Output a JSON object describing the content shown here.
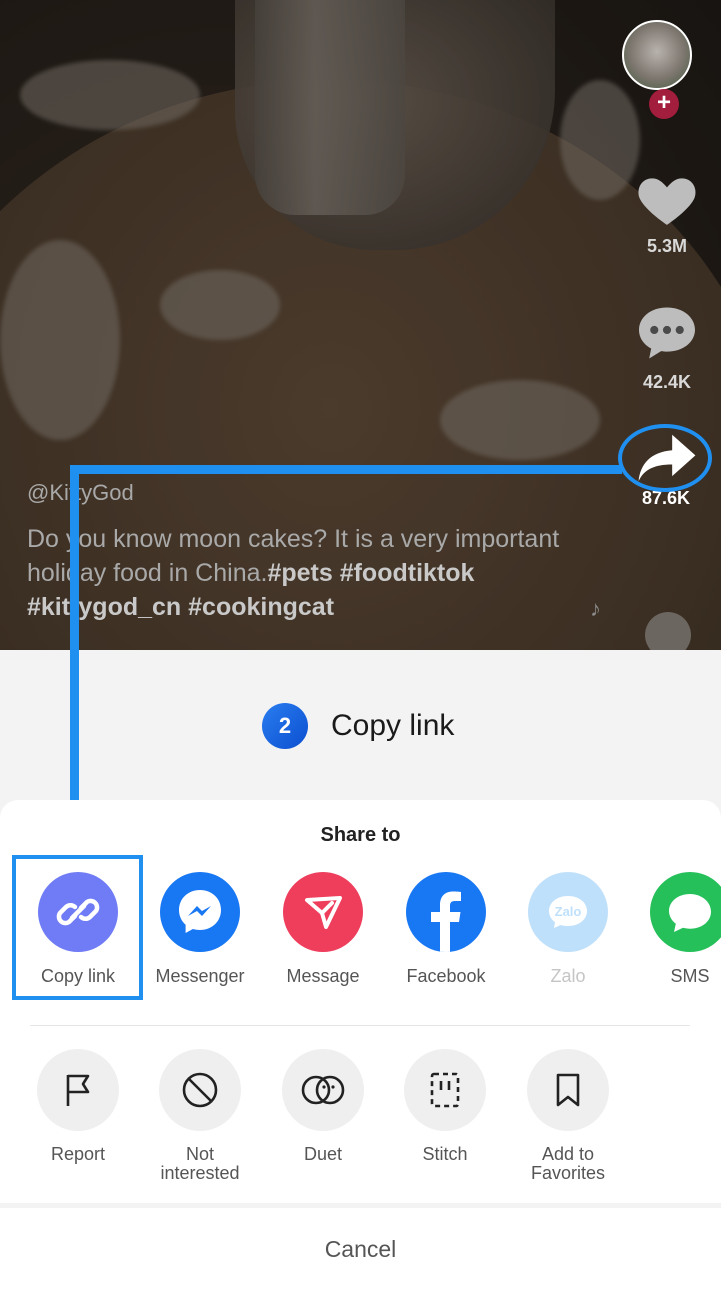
{
  "video": {
    "author": "@KittyGod",
    "caption_text": "Do you know moon cakes? It is a very important holiday food in China.",
    "caption_tags": "#pets #foodtiktok #kittygod_cn #cookingcat",
    "likes": "5.3M",
    "comments": "42.4K",
    "shares": "87.6K"
  },
  "step": {
    "number": "2",
    "label": "Copy link"
  },
  "share_sheet": {
    "title": "Share to",
    "apps": [
      {
        "label": "Copy link",
        "icon": "link-icon",
        "color": "#6f7cf5"
      },
      {
        "label": "Messenger",
        "icon": "messenger-icon",
        "color": "#1877f2"
      },
      {
        "label": "Message",
        "icon": "send-icon",
        "color": "#ef3d5c"
      },
      {
        "label": "Facebook",
        "icon": "facebook-icon",
        "color": "#1877f2"
      },
      {
        "label": "Zalo",
        "icon": "zalo-icon",
        "color": "#bfe0fb"
      },
      {
        "label": "SMS",
        "icon": "sms-icon",
        "color": "#25c05a"
      }
    ],
    "actions": [
      {
        "label": "Report",
        "icon": "flag-icon"
      },
      {
        "label": "Not interested",
        "icon": "block-icon"
      },
      {
        "label": "Duet",
        "icon": "duet-icon"
      },
      {
        "label": "Stitch",
        "icon": "stitch-icon"
      },
      {
        "label": "Add to Favorites",
        "icon": "bookmark-icon"
      }
    ],
    "cancel": "Cancel"
  },
  "colors": {
    "annotation": "#1f8ff0",
    "step_badge": "#0b4fd0"
  }
}
